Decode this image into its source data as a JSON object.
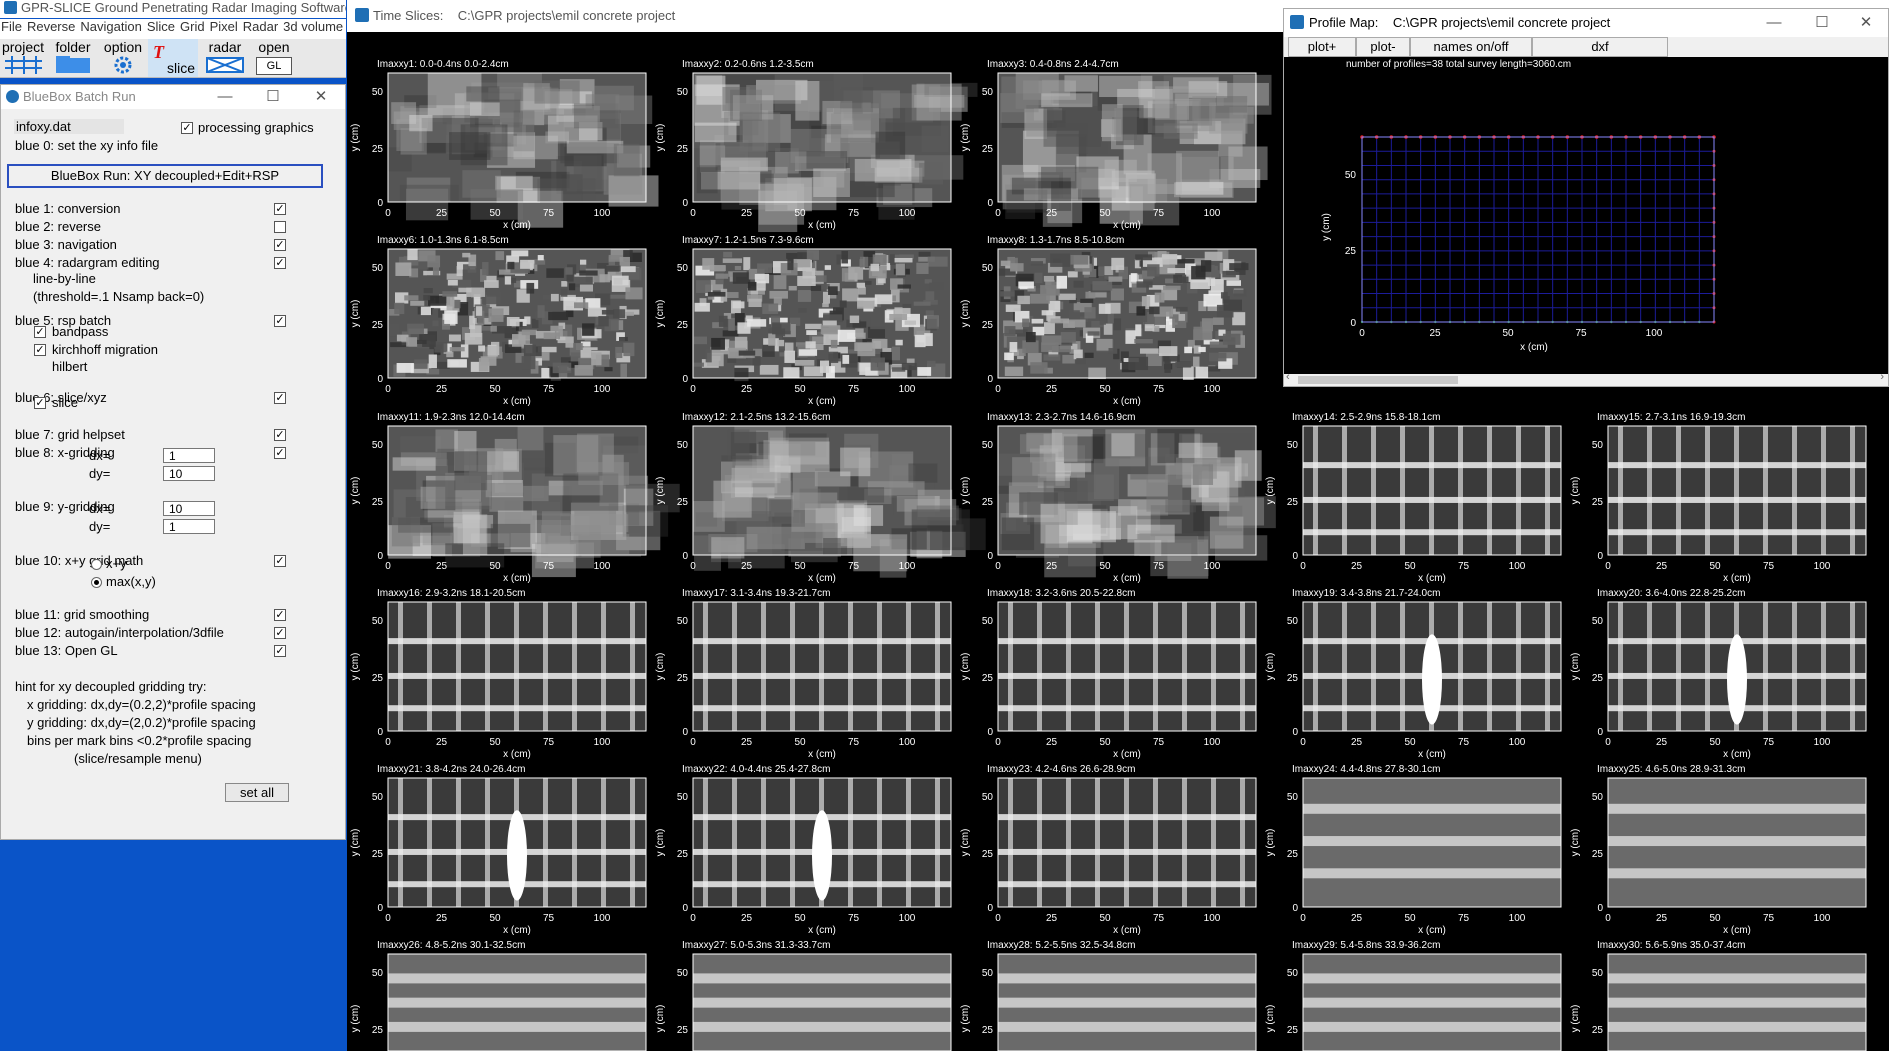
{
  "app": {
    "title": "GPR-SLICE   Ground Penetrating Radar Imaging Software:",
    "menu": [
      "File",
      "Reverse",
      "Navigation",
      "Slice",
      "Grid",
      "Pixel",
      "Radar",
      "3d volume"
    ],
    "toolbar": {
      "project": "project",
      "folder": "folder",
      "option": "option",
      "slice": "slice",
      "radar": "radar",
      "open": "open",
      "gl": "GL"
    }
  },
  "batch": {
    "title": "BlueBox Batch Run",
    "info_file": "infoxy.dat",
    "processing_graphics": "processing graphics",
    "blue0": "blue 0:  set the xy info file",
    "run_button": "BlueBox Run: XY decoupled+Edit+RSP",
    "items": [
      {
        "label": "blue 1: conversion",
        "checked": true
      },
      {
        "label": "blue 2: reverse",
        "checked": false
      },
      {
        "label": "blue 3: navigation",
        "checked": true
      },
      {
        "label": "blue 4: radargram editing",
        "checked": true
      },
      {
        "label": "blue 5: rsp batch",
        "checked": true
      },
      {
        "label": "blue 6: slice/xyz",
        "checked": true
      },
      {
        "label": "blue 7: grid helpset",
        "checked": true
      },
      {
        "label": "blue 8: x-gridding",
        "checked": true
      },
      {
        "label": "blue 9: y-gridding",
        "checked": null
      },
      {
        "label": "blue 10: x+y grid math",
        "checked": true
      },
      {
        "label": "blue 11: grid smoothing",
        "checked": true
      },
      {
        "label": "blue 12: autogain/interpolation/3dfile",
        "checked": true
      },
      {
        "label": "blue 13: Open GL",
        "checked": true
      }
    ],
    "line_by_line": "line-by-line",
    "threshold": "(threshold=.1  Nsamp back=0)",
    "bandpass": "bandpass",
    "kirchhoff": "kirchhoff migration",
    "hilbert": "hilbert",
    "slice": "slice",
    "xgrid": {
      "dx_label": "dx=",
      "dx": "1",
      "dy_label": "dy=",
      "dy": "10"
    },
    "ygrid": {
      "dx_label": "dx=",
      "dx": "10",
      "dy_label": "dy=",
      "dy": "1"
    },
    "math_options": [
      "x+y",
      "max(x,y)"
    ],
    "math_selected": 1,
    "hint": [
      "hint for xy decoupled gridding try:",
      "x gridding: dx,dy=(0.2,2)*profile spacing",
      "y gridding: dx,dy=(2,0.2)*profile spacing",
      "bins per mark bins <0.2*profile spacing",
      "(slice/resample menu)"
    ],
    "set_all": "set all"
  },
  "slices_window": {
    "title": "Time Slices:",
    "path": "C:\\GPR projects\\emil concrete project",
    "x_axis_label": "x (cm)",
    "y_axis_label": "y (cm)",
    "x_ticks": [
      "0",
      "25",
      "50",
      "75",
      "100"
    ],
    "y_ticks": [
      "0",
      "25",
      "50"
    ],
    "slices": [
      {
        "label": "Imaxxy1:  0.0-0.4ns  0.0-2.4cm",
        "pattern": "smooth"
      },
      {
        "label": "Imaxxy2:  0.2-0.6ns  1.2-3.5cm",
        "pattern": "smooth"
      },
      {
        "label": "Imaxxy3:  0.4-0.8ns  2.4-4.7cm",
        "pattern": "smooth"
      },
      {
        "label": "Imaxxy6:  1.0-1.3ns  6.1-8.5cm",
        "pattern": "noisy"
      },
      {
        "label": "Imaxxy7:  1.2-1.5ns  7.3-9.6cm",
        "pattern": "noisy"
      },
      {
        "label": "Imaxxy8:  1.3-1.7ns  8.5-10.8cm",
        "pattern": "noisy"
      },
      {
        "label": "Imaxxy11:  1.9-2.3ns  12.0-14.4cm",
        "pattern": "smooth"
      },
      {
        "label": "Imaxxy12:  2.1-2.5ns  13.2-15.6cm",
        "pattern": "smooth"
      },
      {
        "label": "Imaxxy13:  2.3-2.7ns  14.6-16.9cm",
        "pattern": "smooth"
      },
      {
        "label": "Imaxxy14:  2.5-2.9ns  15.8-18.1cm",
        "pattern": "grid"
      },
      {
        "label": "Imaxxy15:  2.7-3.1ns  16.9-19.3cm",
        "pattern": "grid"
      },
      {
        "label": "Imaxxy16:  2.9-3.2ns  18.1-20.5cm",
        "pattern": "grid"
      },
      {
        "label": "Imaxxy17:  3.1-3.4ns  19.3-21.7cm",
        "pattern": "grid"
      },
      {
        "label": "Imaxxy18:  3.2-3.6ns  20.5-22.8cm",
        "pattern": "grid"
      },
      {
        "label": "Imaxxy19:  3.4-3.8ns  21.7-24.0cm",
        "pattern": "gridblob"
      },
      {
        "label": "Imaxxy20:  3.6-4.0ns  22.8-25.2cm",
        "pattern": "gridblob"
      },
      {
        "label": "Imaxxy21:  3.8-4.2ns  24.0-26.4cm",
        "pattern": "gridblob"
      },
      {
        "label": "Imaxxy22:  4.0-4.4ns  25.4-27.8cm",
        "pattern": "gridblob"
      },
      {
        "label": "Imaxxy23:  4.2-4.6ns  26.6-28.9cm",
        "pattern": "grid"
      },
      {
        "label": "Imaxxy24:  4.4-4.8ns  27.8-30.1cm",
        "pattern": "bands"
      },
      {
        "label": "Imaxxy25:  4.6-5.0ns  28.9-31.3cm",
        "pattern": "bands"
      },
      {
        "label": "Imaxxy26:  4.8-5.2ns  30.1-32.5cm",
        "pattern": "bands"
      },
      {
        "label": "Imaxxy27:  5.0-5.3ns  31.3-33.7cm",
        "pattern": "bands"
      },
      {
        "label": "Imaxxy28:  5.2-5.5ns  32.5-34.8cm",
        "pattern": "bands"
      },
      {
        "label": "Imaxxy29:  5.4-5.8ns  33.9-36.2cm",
        "pattern": "bands"
      },
      {
        "label": "Imaxxy30:  5.6-5.9ns  35.0-37.4cm",
        "pattern": "bands"
      }
    ]
  },
  "profile_map": {
    "title": "Profile Map:",
    "path": "C:\\GPR projects\\emil concrete project",
    "tabs": [
      "plot+",
      "plot-",
      "names on/off",
      "dxf"
    ],
    "info": "number of profiles=38   total survey length=3060.cm",
    "x_label": "x (cm)",
    "y_label": "y (cm)",
    "x_ticks": [
      "0",
      "25",
      "50",
      "75",
      "100"
    ],
    "y_ticks": [
      "0",
      "25",
      "50"
    ],
    "grid_color": "#1c1c9a",
    "marker_color": "#e02020"
  }
}
